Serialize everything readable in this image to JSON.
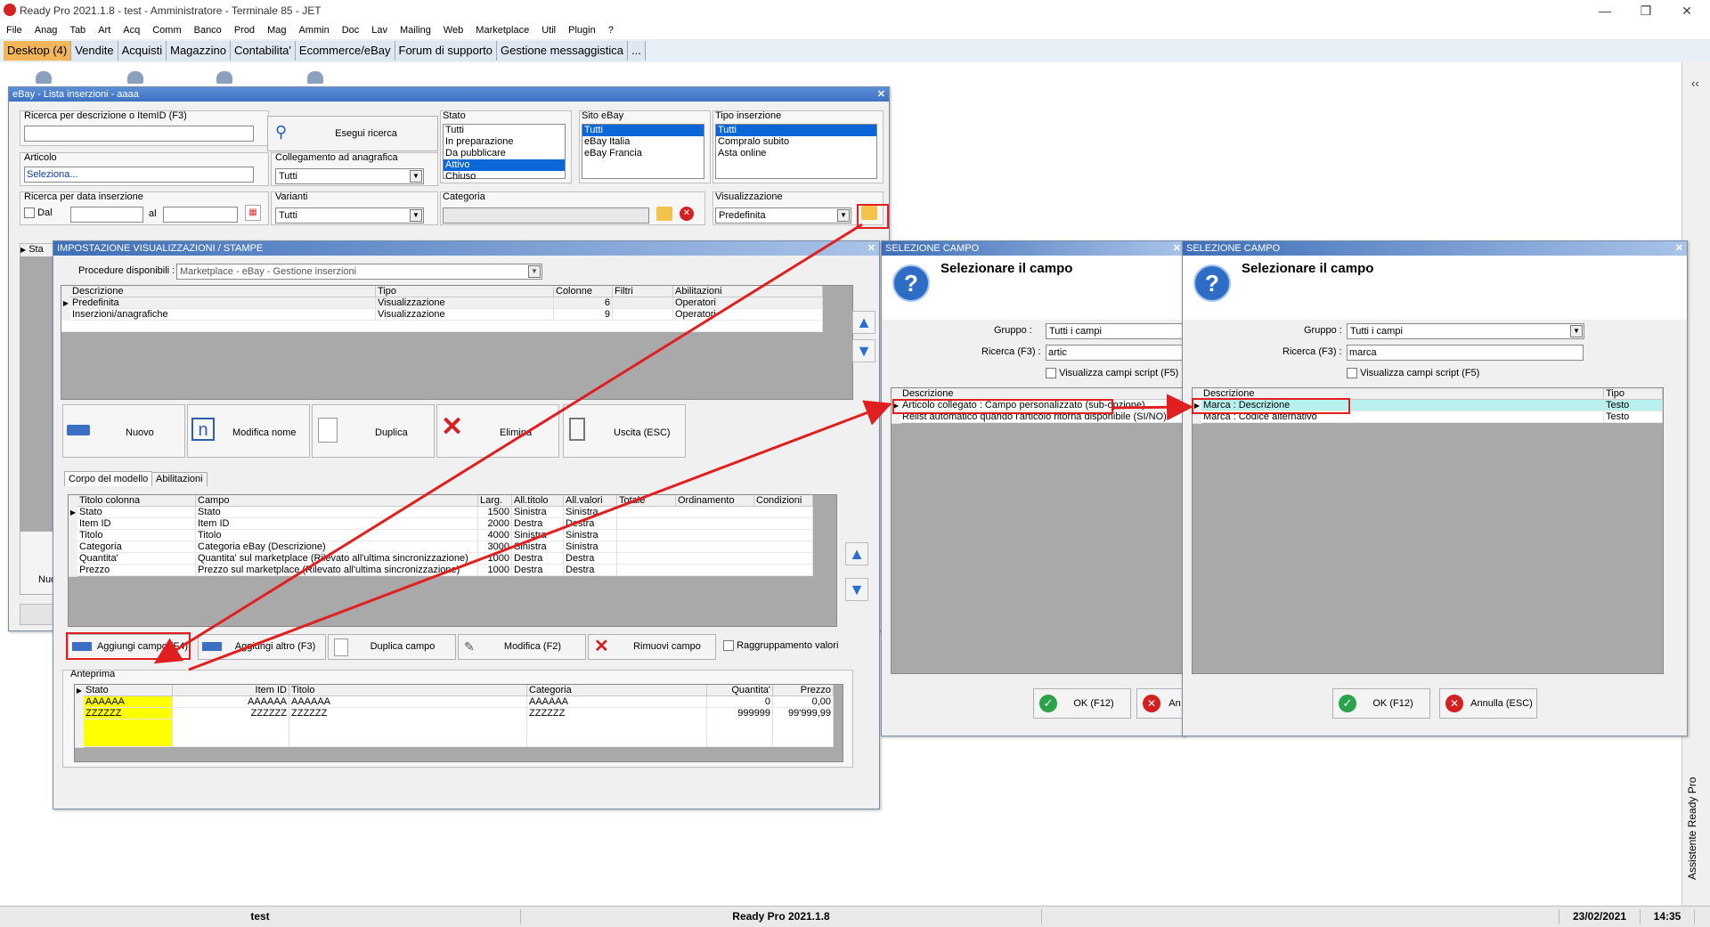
{
  "window": {
    "title": "Ready Pro 2021.1.8 - test - Amministratore - Terminale 85 - JET"
  },
  "menu": [
    "File",
    "Anag",
    "Tab",
    "Art",
    "Acq",
    "Comm",
    "Banco",
    "Prod",
    "Mag",
    "Ammin",
    "Doc",
    "Lav",
    "Mailing",
    "Web",
    "Marketplace",
    "Util",
    "Plugin",
    "?"
  ],
  "tabs": [
    "Desktop (4)",
    "Vendite",
    "Acquisti",
    "Magazzino",
    "Contabilita'",
    "Ecommerce/eBay",
    "Forum di supporto",
    "Gestione messaggistica",
    "..."
  ],
  "ebay_window": {
    "title": "eBay - Lista inserzioni - aaaa",
    "search_label": "Ricerca per descrizione o ItemID (F3)",
    "search_button": "Esegui ricerca",
    "articolo_label": "Articolo",
    "articolo_value": "Seleziona...",
    "collegamento_label": "Collegamento ad anagrafica",
    "collegamento_value": "Tutti",
    "data_label": "Ricerca per data inserzione",
    "dal_label": "Dal",
    "al_label": "al",
    "varianti_label": "Varianti",
    "varianti_value": "Tutti",
    "stato_label": "Stato",
    "stato_items": [
      "Tutti",
      "In preparazione",
      "Da pubblicare",
      "Attivo",
      "Chiuso"
    ],
    "sito_label": "Sito eBay",
    "sito_items": [
      "Tutti",
      "eBay Italia",
      "eBay Francia"
    ],
    "tipo_label": "Tipo inserzione",
    "tipo_items": [
      "Tutti",
      "Compralo subito",
      "Asta online"
    ],
    "categoria_label": "Categoria",
    "visualizzazione_label": "Visualizzazione",
    "visualizzazione_value": "Predefinita",
    "partial_col": "Sta",
    "partial_btn": "Nuo"
  },
  "imp_window": {
    "title": "IMPOSTAZIONE VISUALIZZAZIONI / STAMPE",
    "procedure_label": "Procedure disponibili :",
    "procedure_value": "Marketplace - eBay - Gestione inserzioni",
    "views_headers": [
      "Descrizione",
      "Tipo",
      "Colonne",
      "Filtri",
      "Abilitazioni"
    ],
    "views_rows": [
      [
        "Predefinita",
        "Visualizzazione",
        "6",
        "",
        "Operatori"
      ],
      [
        "Inserzioni/anagrafiche",
        "Visualizzazione",
        "9",
        "",
        "Operatori"
      ]
    ],
    "buttons": [
      "Nuovo",
      "Modifica nome",
      "Duplica",
      "Elimina",
      "Uscita (ESC)"
    ],
    "subtabs": [
      "Corpo del modello",
      "Abilitazioni"
    ],
    "fields_headers": [
      "Titolo colonna",
      "Campo",
      "Larg.",
      "All.titolo",
      "All.valori",
      "Totale",
      "Ordinamento",
      "Condizioni"
    ],
    "fields_rows": [
      [
        "Stato",
        "Stato",
        "1500",
        "Sinistra",
        "Sinistra",
        "",
        "",
        ""
      ],
      [
        "Item ID",
        "Item ID",
        "2000",
        "Destra",
        "Destra",
        "",
        "",
        ""
      ],
      [
        "Titolo",
        "Titolo",
        "4000",
        "Sinistra",
        "Sinistra",
        "",
        "",
        ""
      ],
      [
        "Categoria",
        "Categoria eBay (Descrizione)",
        "3000",
        "Sinistra",
        "Sinistra",
        "",
        "",
        ""
      ],
      [
        "Quantita'",
        "Quantita' sul marketplace (Rilevato all'ultima sincronizzazione)",
        "1000",
        "Destra",
        "Destra",
        "",
        "",
        ""
      ],
      [
        "Prezzo",
        "Prezzo sul marketplace (Rilevato all'ultima sincronizzazione)",
        "1000",
        "Destra",
        "Destra",
        "",
        "",
        ""
      ]
    ],
    "field_buttons": [
      "Aggiungi campo (F4)",
      "Aggiungi altro (F3)",
      "Duplica campo",
      "Modifica (F2)",
      "Rimuovi campo"
    ],
    "raggruppamento": "Raggruppamento valori",
    "anteprima_label": "Anteprima",
    "preview_headers": [
      "Stato",
      "Item ID",
      "Titolo",
      "Categoria",
      "Quantita'",
      "Prezzo"
    ],
    "preview_rows": [
      [
        "AAAAAA",
        "AAAAAA",
        "AAAAAA",
        "AAAAAA",
        "0",
        "0,00"
      ],
      [
        "ZZZZZZ",
        "ZZZZZZ",
        "ZZZZZZ",
        "ZZZZZZ",
        "999999",
        "99'999,99"
      ]
    ]
  },
  "sel1": {
    "title": "SELEZIONE CAMPO",
    "heading": "Selezionare il campo",
    "gruppo_label": "Gruppo :",
    "gruppo_value": "Tutti i campi",
    "ricerca_label": "Ricerca (F3) :",
    "ricerca_value": "artic",
    "script_label": "Visualizza campi script (F5)",
    "col_desc": "Descrizione",
    "rows": [
      "Articolo collegato : Campo personalizzato (sub-opzione)",
      "Relist automatico quando l'articolo ritorna disponibile (SI/NO)"
    ],
    "ok": "OK (F12)",
    "cancel": "An"
  },
  "sel2": {
    "title": "SELEZIONE CAMPO",
    "heading": "Selezionare il campo",
    "gruppo_label": "Gruppo :",
    "gruppo_value": "Tutti i campi",
    "ricerca_label": "Ricerca (F3) :",
    "ricerca_value": "marca",
    "script_label": "Visualizza campi script (F5)",
    "col_desc": "Descrizione",
    "col_tipo": "Tipo",
    "rows": [
      [
        "Marca : Descrizione",
        "Testo"
      ],
      [
        "Marca : Codice alternativo",
        "Testo"
      ]
    ],
    "ok": "OK (F12)",
    "cancel": "Annulla (ESC)"
  },
  "assistant": "Assistente Ready Pro",
  "status": {
    "user": "test",
    "version": "Ready Pro 2021.1.8",
    "date": "23/02/2021",
    "time": "14:35"
  }
}
